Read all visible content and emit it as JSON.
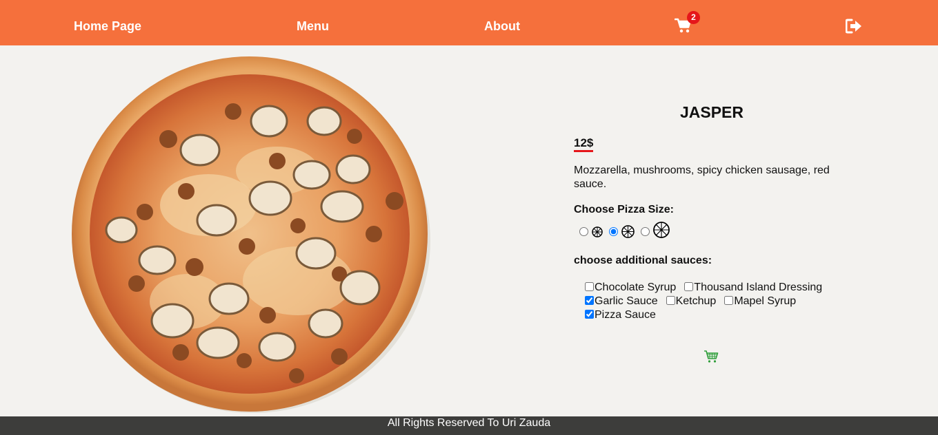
{
  "nav": {
    "home_label": "Home Page",
    "menu_label": "Menu",
    "about_label": "About",
    "cart_count": "2"
  },
  "product": {
    "name": "JASPER",
    "price": "12$",
    "description": "Mozzarella, mushrooms, spicy chicken sausage, red sauce.",
    "size_label": "Choose Pizza Size:",
    "sizes": [
      {
        "checked": false
      },
      {
        "checked": true
      },
      {
        "checked": false
      }
    ],
    "sauces_label": "choose additional sauces:",
    "sauces": [
      {
        "label": "Chocolate Syrup",
        "checked": false
      },
      {
        "label": "Thousand Island Dressing",
        "checked": false
      },
      {
        "label": "Garlic Sauce",
        "checked": true
      },
      {
        "label": "Ketchup",
        "checked": false
      },
      {
        "label": "Mapel Syrup",
        "checked": false
      },
      {
        "label": "Pizza Sauce",
        "checked": true
      }
    ]
  },
  "footer": {
    "text": "All Rights Reserved To Uri Zauda"
  },
  "colors": {
    "navbar": "#f5703c",
    "badge": "#e5161a",
    "footer": "#3d3d3b",
    "background": "#f3f2ef",
    "add_cart_icon": "#2e9e3a"
  }
}
